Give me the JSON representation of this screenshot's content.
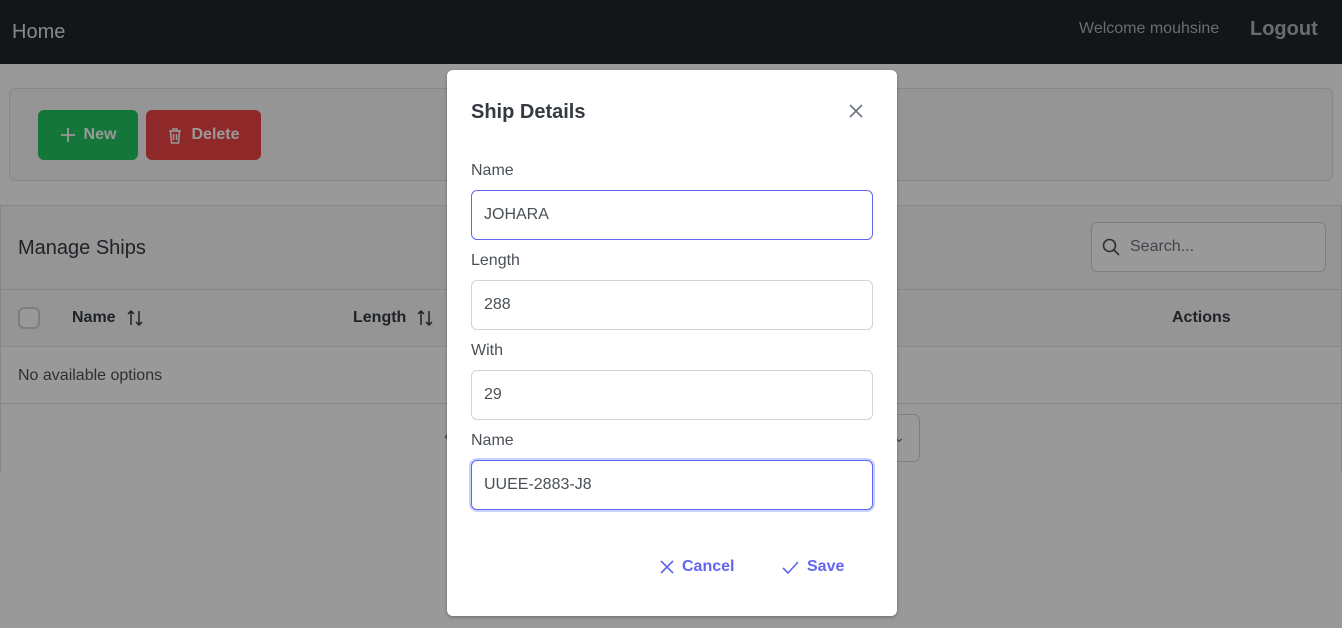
{
  "navbar": {
    "home_label": "Home",
    "welcome_text": "Welcome mouhsine",
    "logout_label": "Logout"
  },
  "toolbar": {
    "new_label": "New",
    "delete_label": "Delete",
    "new_icon": "plus-icon",
    "delete_icon": "trash-icon"
  },
  "table": {
    "title": "Manage Ships",
    "search_placeholder": "Search...",
    "columns": [
      {
        "label": "Name",
        "sortable": true
      },
      {
        "label": "Length",
        "sortable": true
      },
      {
        "label": "Actions",
        "sortable": false
      }
    ],
    "empty_message": "No available options"
  },
  "dialog": {
    "title": "Ship Details",
    "fields": [
      {
        "label": "Name",
        "value": "JOHARA"
      },
      {
        "label": "Length",
        "value": "288"
      },
      {
        "label": "With",
        "value": "29"
      },
      {
        "label": "Name",
        "value": "UUEE-2883-J8"
      }
    ],
    "cancel_label": "Cancel",
    "save_label": "Save"
  },
  "colors": {
    "navbar_bg": "#212529",
    "success": "#22c55e",
    "danger": "#ef4444",
    "primary": "#6366f1"
  }
}
